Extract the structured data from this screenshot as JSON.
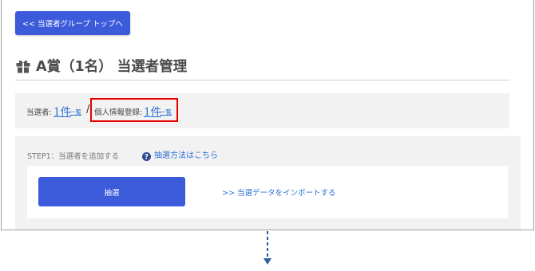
{
  "nav": {
    "back_label": "<< 当選者グループ トップへ"
  },
  "page": {
    "title": "A賞（1名） 当選者管理"
  },
  "summary": {
    "winners_label": "当選者:",
    "winners_count": "1件",
    "winners_list_link": "一覧",
    "separator": "/",
    "personal_info_label": "個人情報登録:",
    "personal_info_count": "1件",
    "personal_info_list_link": "一覧"
  },
  "step1": {
    "label": "STEP1：当選者を追加する",
    "help_link": "抽選方法はこちら",
    "draw_button": "抽選",
    "import_link": ">> 当選データをインポートする"
  },
  "colors": {
    "primary": "#3b5bdb",
    "link": "#2c6fd6",
    "highlight": "#e60000",
    "panel_bg": "#f2f2f2"
  },
  "icons": {
    "title_icon": "gift-icon",
    "help_icon": "question-circle-icon",
    "flow_arrow": "dashed-arrow-down-icon"
  }
}
